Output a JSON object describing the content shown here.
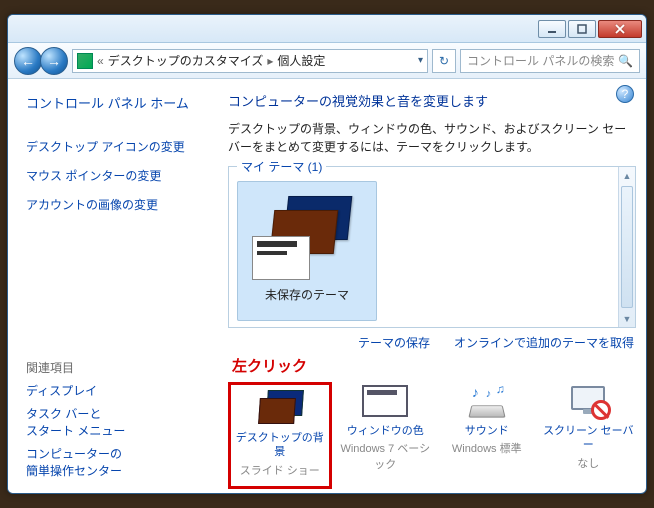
{
  "titlebar": {
    "minimize_icon": "minimize",
    "maximize_icon": "maximize",
    "close_icon": "close"
  },
  "nav": {
    "back_icon": "←",
    "forward_icon": "→",
    "breadcrumb_prefix": "«",
    "breadcrumb_parent": "デスクトップのカスタマイズ",
    "breadcrumb_sep": "▸",
    "breadcrumb_current": "個人設定",
    "dropdown_icon": "▾",
    "refresh_icon": "↻",
    "search_placeholder": "コントロール パネルの検索",
    "search_icon": "🔍"
  },
  "sidebar": {
    "home": "コントロール パネル ホーム",
    "links": [
      "デスクトップ アイコンの変更",
      "マウス ポインターの変更",
      "アカウントの画像の変更"
    ],
    "related_header": "関連項目",
    "related": [
      "ディスプレイ",
      "タスク バーと\nスタート メニュー",
      "コンピューターの\n簡単操作センター"
    ]
  },
  "content": {
    "help_icon": "?",
    "heading": "コンピューターの視覚効果と音を変更します",
    "description": "デスクトップの背景、ウィンドウの色、サウンド、およびスクリーン セーバーをまとめて変更するには、テーマをクリックします。",
    "themes_legend": "マイ テーマ (1)",
    "theme_item_label": "未保存のテーマ",
    "save_theme_link": "テーマの保存",
    "online_themes_link": "オンラインで追加のテーマを取得",
    "annotation": "左クリック",
    "bottom": [
      {
        "label": "デスクトップの背景",
        "sub": "スライド ショー",
        "icon": "wallpaper"
      },
      {
        "label": "ウィンドウの色",
        "sub": "Windows 7 ベーシック",
        "icon": "window-color"
      },
      {
        "label": "サウンド",
        "sub": "Windows 標準",
        "icon": "sound"
      },
      {
        "label": "スクリーン セーバー",
        "sub": "なし",
        "icon": "screensaver"
      }
    ]
  }
}
